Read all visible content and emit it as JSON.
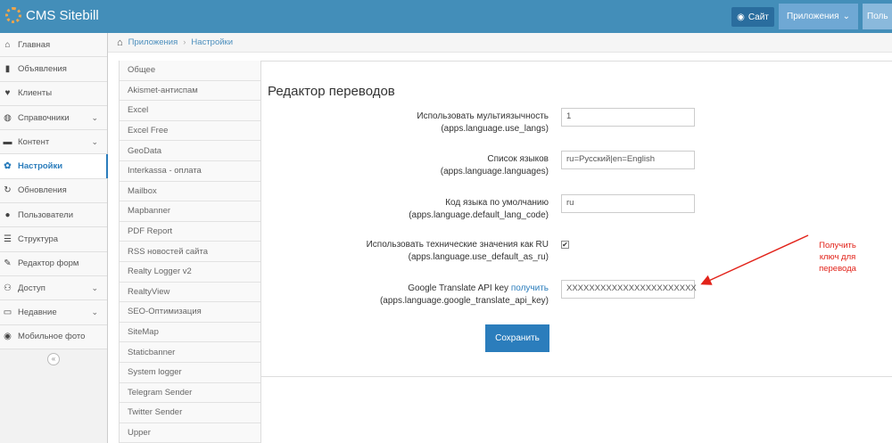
{
  "navbar": {
    "brand": "CMS Sitebill",
    "site_label": "Сайт",
    "apps_label": "Приложения",
    "user_label": "Поль"
  },
  "sidebar": {
    "items": [
      {
        "label": "Главная",
        "icon": "home-icon",
        "glyph": "⌂"
      },
      {
        "label": "Объявления",
        "icon": "book-icon",
        "glyph": "▮"
      },
      {
        "label": "Клиенты",
        "icon": "heart-icon",
        "glyph": "♥"
      },
      {
        "label": "Справочники",
        "icon": "globe-icon",
        "glyph": "◍"
      },
      {
        "label": "Контент",
        "icon": "coffee-icon",
        "glyph": "▬"
      },
      {
        "label": "Настройки",
        "icon": "cog-icon",
        "glyph": "✿"
      },
      {
        "label": "Обновления",
        "icon": "refresh-icon",
        "glyph": "↻"
      },
      {
        "label": "Пользователи",
        "icon": "user-icon",
        "glyph": "●"
      },
      {
        "label": "Структура",
        "icon": "list-icon",
        "glyph": "☰"
      },
      {
        "label": "Редактор форм",
        "icon": "edit-icon",
        "glyph": "✎"
      },
      {
        "label": "Доступ",
        "icon": "group-icon",
        "glyph": "⚇"
      },
      {
        "label": "Недавние",
        "icon": "desktop-icon",
        "glyph": "▭"
      },
      {
        "label": "Мобильное фото",
        "icon": "camera-icon",
        "glyph": "◉"
      }
    ],
    "collapse_glyph": "«"
  },
  "breadcrumb": {
    "items": [
      "Приложения",
      "Настройки"
    ]
  },
  "settings": {
    "items": [
      "Общее",
      "Akismet-антиспам",
      "Excel",
      "Excel Free",
      "GeoData",
      "Interkassa - оплата",
      "Mailbox",
      "Mapbanner",
      "PDF Report",
      "RSS новостей сайта",
      "Realty Logger v2",
      "RealtyView",
      "SEO-Оптимизация",
      "SiteMap",
      "Staticbanner",
      "System logger",
      "Telegram Sender",
      "Twitter Sender",
      "Upper"
    ]
  },
  "form": {
    "title": "Редактор переводов",
    "fields": [
      {
        "label": "Использовать мультиязычность",
        "key": "(apps.language.use_langs)",
        "value": "1"
      },
      {
        "label": "Список языков",
        "key": "(apps.language.languages)",
        "value": "ru=Русский|en=English"
      },
      {
        "label": "Код языка по умолчанию",
        "key": "(apps.language.default_lang_code)",
        "value": "ru"
      },
      {
        "label": "Использовать технические значения как RU",
        "key": "(apps.language.use_default_as_ru)",
        "checked": true,
        "check_glyph": "✔"
      },
      {
        "label": "Google Translate API key",
        "link": "получить",
        "key": "(apps.language.google_translate_api_key)",
        "value": "XXXXXXXXXXXXXXXXXXXXXXX"
      }
    ],
    "save_label": "Сохранить"
  },
  "annotation": {
    "text": "Получить ключ для перевода",
    "color": "#e2231a"
  },
  "colors": {
    "navbar": "#438eb9",
    "accent": "#2b7dbc"
  }
}
